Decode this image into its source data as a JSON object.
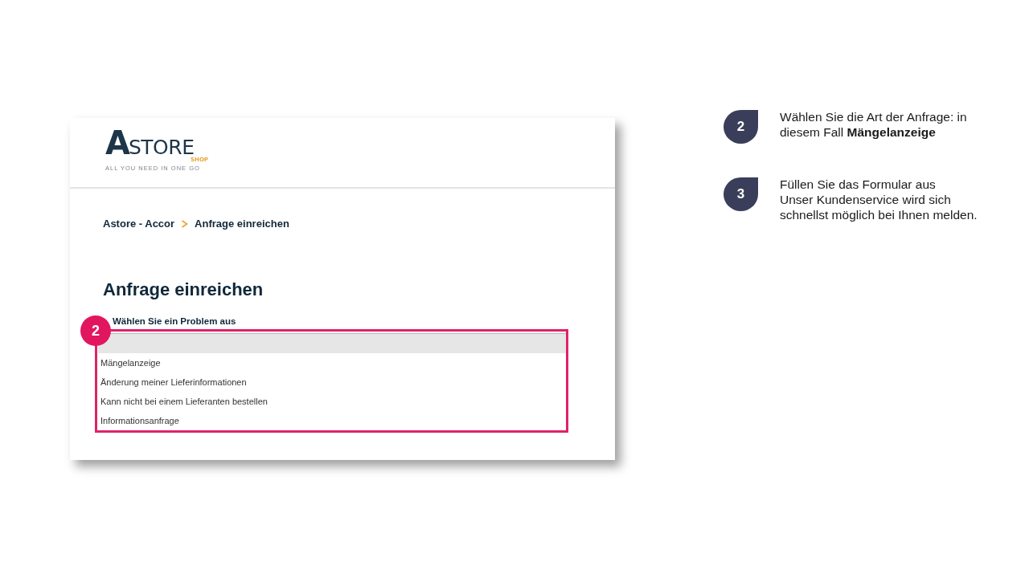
{
  "screenshot": {
    "logo": {
      "initial": "A",
      "rest": "STORE",
      "sub": "SHOP",
      "tagline": "ALL YOU NEED IN ONE GO"
    },
    "breadcrumb": [
      {
        "label": "Astore - Accor"
      },
      {
        "label": "Anfrage einreichen"
      }
    ],
    "heading": "Anfrage einreichen",
    "field_label": "Wählen Sie ein Problem aus",
    "dropdown": {
      "options": [
        {
          "selected": true
        },
        {
          "label": "Mängelanzeige",
          "selected": false
        },
        {
          "label": "Änderung meiner Lieferinformationen",
          "selected": false
        },
        {
          "label": "Kann nicht bei einem Lieferanten bestellen",
          "selected": false
        },
        {
          "label": "Informationsanfrage",
          "selected": false
        }
      ]
    },
    "callout": {
      "number": "2"
    }
  },
  "steps": [
    {
      "number": "2",
      "lines": [
        "Wählen Sie die Art der Anfrage: in diesem Fall **Mängelanzeige**"
      ]
    },
    {
      "number": "3",
      "lines": [
        "Füllen Sie das Formular aus",
        "Unser Kundenservice wird sich schnellst möglich bei Ihnen melden."
      ]
    }
  ]
}
